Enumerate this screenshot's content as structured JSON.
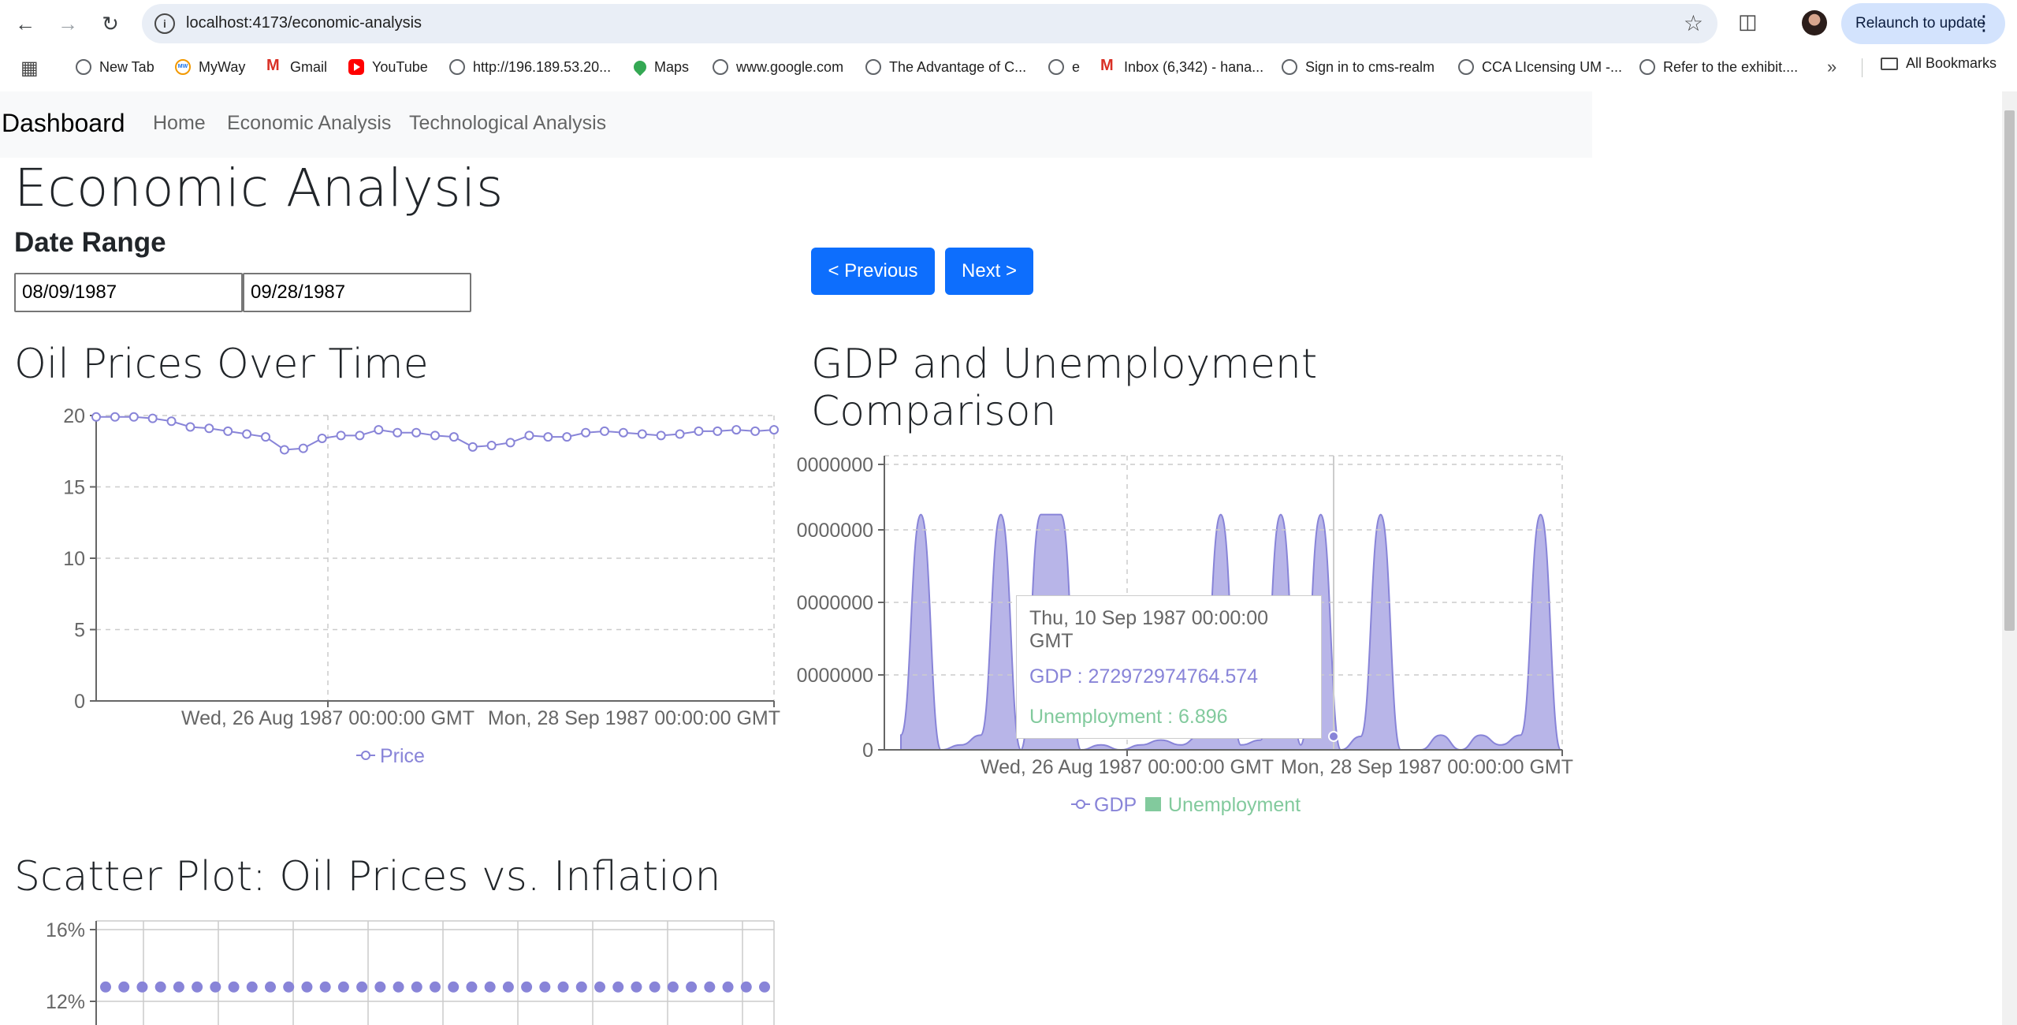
{
  "browser": {
    "url": "localhost:4173/economic-analysis",
    "relaunch_label": "Relaunch to update",
    "bookmarks": [
      {
        "label": "New Tab",
        "icon": "globe-icon"
      },
      {
        "label": "MyWay",
        "icon": "myway-icon"
      },
      {
        "label": "Gmail",
        "icon": "gmail-icon"
      },
      {
        "label": "YouTube",
        "icon": "youtube-icon"
      },
      {
        "label": "http://196.189.53.20...",
        "icon": "globe-icon"
      },
      {
        "label": "Maps",
        "icon": "maps-icon"
      },
      {
        "label": "www.google.com",
        "icon": "globe-icon"
      },
      {
        "label": "The Advantage of C...",
        "icon": "globe-icon"
      },
      {
        "label": "e",
        "icon": "globe-icon"
      },
      {
        "label": "Inbox (6,342) - hana...",
        "icon": "gmail-icon"
      },
      {
        "label": "Sign in to cms-realm",
        "icon": "globe-icon"
      },
      {
        "label": "CCA LIcensing UM -...",
        "icon": "globe-icon"
      },
      {
        "label": "Refer to the exhibit....",
        "icon": "globe-icon"
      }
    ],
    "more_label": "»",
    "all_bookmarks_label": "All Bookmarks"
  },
  "navbar": {
    "brand": "Dashboard",
    "links": [
      "Home",
      "Economic Analysis",
      "Technological Analysis"
    ]
  },
  "page": {
    "title": "Economic Analysis",
    "date_range_label": "Date Range",
    "start_date": "08/09/1987",
    "end_date": "09/28/1987",
    "prev_label": "< Previous",
    "next_label": "Next >"
  },
  "colors": {
    "gdp": "#8884d8",
    "unemployment": "#82ca9d",
    "primary_button": "#0d6efd"
  },
  "chart_data": [
    {
      "type": "line",
      "title": "Oil Prices Over Time",
      "series": [
        {
          "name": "Price",
          "values": [
            19.9,
            19.9,
            19.9,
            19.8,
            19.6,
            19.2,
            19.1,
            18.9,
            18.7,
            18.5,
            17.6,
            17.7,
            18.4,
            18.6,
            18.6,
            19.0,
            18.8,
            18.8,
            18.6,
            18.5,
            17.8,
            17.9,
            18.1,
            18.6,
            18.5,
            18.5,
            18.8,
            18.9,
            18.8,
            18.7,
            18.6,
            18.7,
            18.9,
            18.9,
            19.0,
            18.9,
            19.0
          ]
        }
      ],
      "x_ticks": [
        "Wed, 26 Aug 1987 00:00:00 GMT",
        "Mon, 28 Sep 1987 00:00:00 GMT"
      ],
      "y_ticks": [
        "0",
        "5",
        "10",
        "15",
        "20"
      ],
      "ylim": [
        0,
        20
      ],
      "grid": true,
      "legend": "bottom"
    },
    {
      "type": "area",
      "title": "GDP and Unemployment Comparison",
      "series": [
        {
          "name": "GDP",
          "values": [
            300000000000,
            4800000000000,
            0,
            100000000000,
            300000000000,
            4800000000000,
            0,
            4800000000000,
            4800000000000,
            0,
            100000000000,
            0,
            100000000000,
            200000000000,
            100000000000,
            300000000000,
            4800000000000,
            100000000000,
            200000000000,
            4800000000000,
            100000000000,
            4800000000000,
            0,
            272972974764.574,
            4800000000000,
            0,
            0,
            300000000000,
            0,
            300000000000,
            100000000000,
            300000000000,
            4800000000000,
            0
          ]
        },
        {
          "name": "Unemployment",
          "values": [
            6.9,
            6.9,
            6.9,
            6.9,
            6.9,
            6.9,
            6.9,
            6.9,
            6.9,
            6.9,
            6.9,
            6.9,
            6.9,
            6.9,
            6.9,
            6.9,
            6.9,
            6.9,
            6.9,
            6.9,
            6.9,
            6.9,
            6.9,
            6.896,
            6.9,
            6.9,
            6.9,
            6.9,
            6.9,
            6.9,
            6.9,
            6.9,
            6.9,
            6.9
          ]
        }
      ],
      "x_ticks": [
        "Wed, 26 Aug 1987 00:00:00 GMT",
        "Mon, 28 Sep 1987 00:00:00 GMT"
      ],
      "y_ticks": [
        "0",
        "0000000",
        "0000000",
        "0000000",
        "0000000"
      ],
      "ylim": [
        0,
        6000000000000
      ],
      "grid": true,
      "legend": "bottom",
      "tooltip": {
        "date": "Thu, 10 Sep 1987 00:00:00 GMT",
        "gdp_text": "GDP : 272972974764.574",
        "unemployment_text": "Unemployment : 6.896"
      }
    },
    {
      "type": "scatter",
      "title": "Scatter Plot: Oil Prices vs. Inflation",
      "series": [
        {
          "name": "",
          "values": [
            12.8,
            12.8,
            12.8,
            12.8,
            12.8,
            12.8,
            12.8,
            12.8,
            12.8,
            12.8,
            12.8,
            12.8,
            12.8,
            12.8,
            12.8,
            12.8,
            12.8,
            12.8,
            12.8,
            12.8,
            12.8,
            12.8,
            12.8,
            12.8,
            12.8,
            12.8,
            12.8,
            12.8,
            12.8,
            12.8,
            12.8,
            12.8,
            12.8,
            12.8,
            12.8,
            12.8,
            12.8
          ]
        }
      ],
      "y_ticks": [
        "16%",
        "12%"
      ],
      "ylim": [
        12,
        16
      ],
      "grid": true
    }
  ]
}
